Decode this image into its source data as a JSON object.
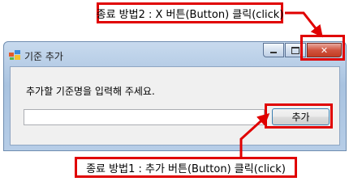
{
  "window": {
    "title": "기준 추가",
    "icon": "app-window-icon",
    "prompt": "추가할 기준명을 입력해 주세요.",
    "input_value": "",
    "add_button_label": "추가",
    "caption_buttons": [
      "minimize-icon",
      "maximize-icon",
      "close-icon"
    ]
  },
  "annotations": {
    "top_label": "종료 방법2 : X 버튼(Button) 클릭(click)",
    "bottom_label": "종료 방법1 : 추가 버튼(Button) 클릭(click)",
    "highlight_color": "#e00000"
  }
}
